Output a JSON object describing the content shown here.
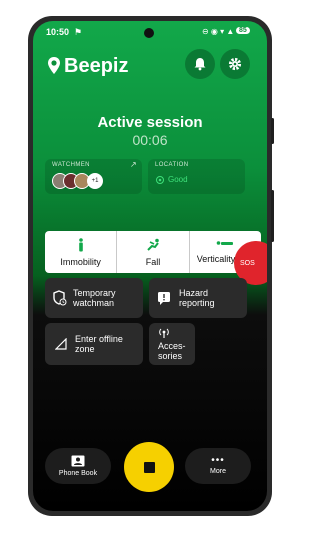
{
  "status_bar": {
    "time": "10:50",
    "battery": "85"
  },
  "app": {
    "name": "Beepiz"
  },
  "session": {
    "title": "Active session",
    "timer": "00:06"
  },
  "watchmen": {
    "label": "WATCHMEN",
    "extra_count": "+1"
  },
  "location": {
    "label": "LOCATION",
    "status": "Good"
  },
  "modes": [
    {
      "label": "Immobility"
    },
    {
      "label": "Fall"
    },
    {
      "label": "Verticality loss"
    }
  ],
  "sos": {
    "label": "SOS"
  },
  "tiles": {
    "temporary_watchman": "Temporary watchman",
    "hazard_reporting": "Hazard reporting",
    "offline_zone": "Enter offline zone",
    "accessories": "Acces-sories"
  },
  "bottom": {
    "phone_book": "Phone Book",
    "more": "More"
  },
  "colors": {
    "accent_yellow": "#f6d000",
    "brand_green": "#12a84a",
    "sos_red": "#e0242c"
  }
}
